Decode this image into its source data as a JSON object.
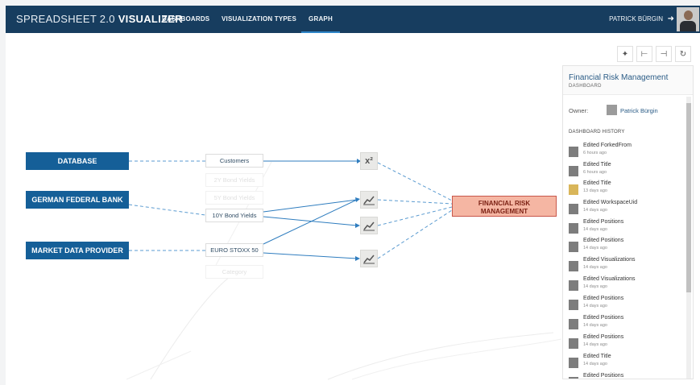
{
  "app": {
    "brand_light": "SPREADSHEET 2.0",
    "brand_bold": "VISUALIZER"
  },
  "nav": {
    "dashboards": "DASHBOARDS",
    "visualization_types": "VISUALIZATION TYPES",
    "graph": "GRAPH",
    "active": "graph"
  },
  "user": {
    "name": "PATRICK BÜRGIN",
    "logout_icon": "logout-arrow-icon"
  },
  "toolbar": {
    "center_icon": "crosshair-icon",
    "layout_h_icon": "layout-horizontal-icon",
    "layout_v_icon": "layout-vertical-icon",
    "refresh_icon": "refresh-icon"
  },
  "graph": {
    "sources": [
      "DATABASE",
      "GERMAN FEDERAL BANK",
      "MARKET DATA PROVIDER"
    ],
    "columns": {
      "customers": "Customers",
      "faded_2y": "2Y Bond Yields",
      "faded_5y": "5Y Bond Yields",
      "yields_10y": "10Y Bond Yields",
      "eurostoxx": "EURO STOXX 50",
      "faded_category": "Category"
    },
    "operators": {
      "square": "x²",
      "chart_icon": "line-chart-icon"
    },
    "target": {
      "line1": "FINANCIAL RISK",
      "line2": "MANAGEMENT"
    }
  },
  "panel": {
    "title": "Financial Risk Management",
    "subtitle": "DASHBOARD",
    "owner_label": "Owner:",
    "owner_name": "Patrick Bürgin",
    "history_label": "DASHBOARD HISTORY",
    "history": [
      {
        "title": "Edited ForkedFrom",
        "when": "6 hours ago"
      },
      {
        "title": "Edited Title",
        "when": "6 hours ago"
      },
      {
        "title": "Edited Title",
        "when": "13 days ago"
      },
      {
        "title": "Edited WorkspaceUid",
        "when": "14 days ago"
      },
      {
        "title": "Edited Positions",
        "when": "14 days ago"
      },
      {
        "title": "Edited Positions",
        "when": "14 days ago"
      },
      {
        "title": "Edited Visualizations",
        "when": "14 days ago"
      },
      {
        "title": "Edited Visualizations",
        "when": "14 days ago"
      },
      {
        "title": "Edited Positions",
        "when": "14 days ago"
      },
      {
        "title": "Edited Positions",
        "when": "14 days ago"
      },
      {
        "title": "Edited Positions",
        "when": "14 days ago"
      },
      {
        "title": "Edited Title",
        "when": "14 days ago"
      },
      {
        "title": "Edited Positions",
        "when": ""
      }
    ]
  },
  "colors": {
    "nav_bg": "#173d5f",
    "source_bg": "#155f98",
    "target_bg": "#f5b6a3",
    "target_border": "#c8574b",
    "link": "#2f7dbf"
  }
}
